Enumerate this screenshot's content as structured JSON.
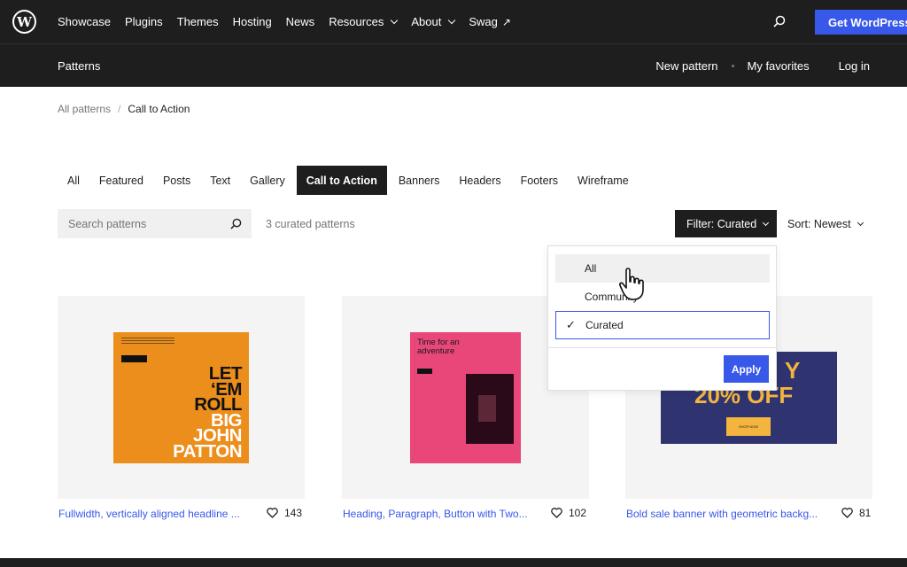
{
  "header": {
    "logo_letter": "W",
    "nav": [
      {
        "label": "Showcase"
      },
      {
        "label": "Plugins"
      },
      {
        "label": "Themes"
      },
      {
        "label": "Hosting"
      },
      {
        "label": "News"
      },
      {
        "label": "Resources",
        "icon": "chevron-down-icon"
      },
      {
        "label": "About",
        "icon": "chevron-down-icon"
      },
      {
        "label": "Swag",
        "icon": "external-link-icon"
      }
    ],
    "search_icon": "search-icon",
    "cta_label": "Get WordPress",
    "cta_color": "#3858e9"
  },
  "subheader": {
    "title": "Patterns",
    "new_pattern": "New pattern",
    "favorites": "My favorites",
    "login": "Log in"
  },
  "breadcrumb": {
    "root": "All patterns",
    "separator": "/",
    "current": "Call to Action"
  },
  "categories": [
    {
      "label": "All",
      "active": false
    },
    {
      "label": "Featured",
      "active": false
    },
    {
      "label": "Posts",
      "active": false
    },
    {
      "label": "Text",
      "active": false
    },
    {
      "label": "Gallery",
      "active": false
    },
    {
      "label": "Call to Action",
      "active": true
    },
    {
      "label": "Banners",
      "active": false
    },
    {
      "label": "Headers",
      "active": false
    },
    {
      "label": "Footers",
      "active": false
    },
    {
      "label": "Wireframe",
      "active": false
    }
  ],
  "search": {
    "placeholder": "Search patterns",
    "result_count": "3 curated patterns"
  },
  "filter": {
    "label": "Filter: Curated",
    "options": [
      {
        "label": "All",
        "hovered": true,
        "selected": false
      },
      {
        "label": "Community",
        "hovered": false,
        "selected": false
      },
      {
        "label": "Curated",
        "hovered": false,
        "selected": true
      }
    ],
    "check_glyph": "✓",
    "apply_label": "Apply"
  },
  "sort": {
    "label": "Sort: Newest"
  },
  "patterns": [
    {
      "title": "Fullwidth, vertically aligned headline ...",
      "likes": "143",
      "preview_lines": [
        "LET",
        "‘EM",
        "ROLL",
        "BIG",
        "JOHN",
        "PATTON"
      ],
      "preview_color": "#ec8e1c"
    },
    {
      "title": "Heading, Paragraph, Button with Two...",
      "likes": "102",
      "preview_heading": "Time for an adventure",
      "preview_color": "#e9467a"
    },
    {
      "title": "Bold sale banner with geometric backg...",
      "likes": "81",
      "preview_line1": "Y",
      "preview_line2": "20% OFF",
      "preview_button": "SHOP NOW",
      "preview_color": "#2f3470"
    }
  ]
}
